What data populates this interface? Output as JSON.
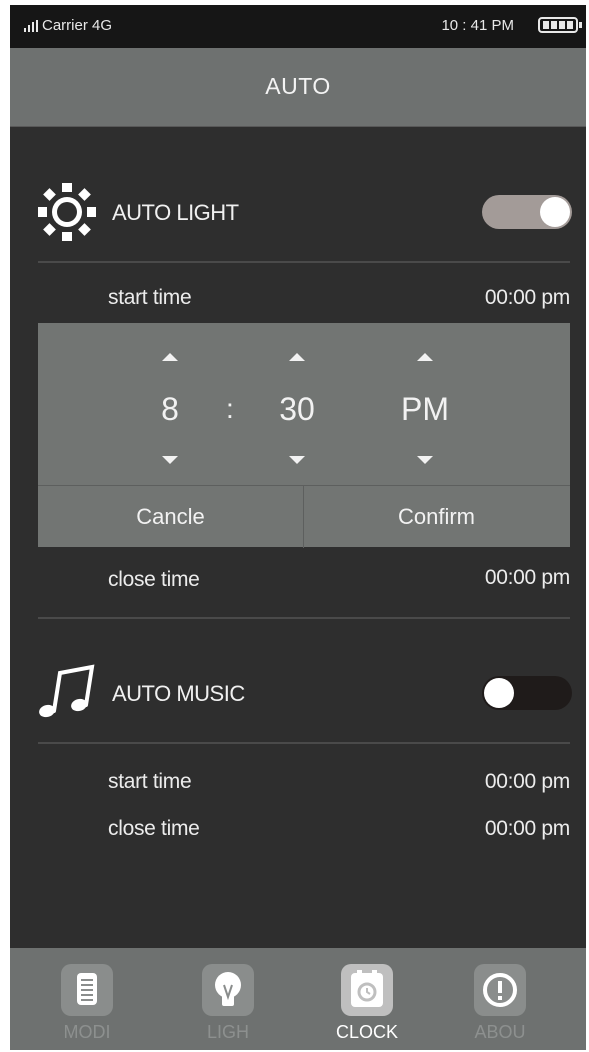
{
  "status_bar": {
    "carrier": "Carrier",
    "network": "4G",
    "time": "10 : 41 PM"
  },
  "header": {
    "title": "AUTO"
  },
  "auto_light": {
    "label": "AUTO LIGHT",
    "icon": "sun-icon",
    "enabled": true,
    "start_time_label": "start time",
    "start_time_value": "00:00 pm",
    "close_time_label": "close time",
    "close_time_value": "00:00 pm"
  },
  "time_picker": {
    "hour": "8",
    "separator": ":",
    "minute": "30",
    "ampm": "PM",
    "cancel_label": "Cancle",
    "confirm_label": "Confirm"
  },
  "auto_music": {
    "label": "AUTO MUSIC",
    "icon": "music-note-icon",
    "enabled": false,
    "start_time_label": "start time",
    "start_time_value": "00:00 pm",
    "close_time_label": "close time",
    "close_time_value": "00:00 pm"
  },
  "tabs": [
    {
      "label": "MODI",
      "icon": "document-icon",
      "active": false
    },
    {
      "label": "LIGH",
      "icon": "bulb-icon",
      "active": false
    },
    {
      "label": "CLOCK",
      "icon": "clock-icon",
      "active": true
    },
    {
      "label": "ABOU",
      "icon": "info-icon",
      "active": false
    }
  ],
  "colors": {
    "background": "#2e2e2e",
    "header": "#6e7170",
    "toggle_on": "#a39b98",
    "toggle_off": "#1f1b1a"
  }
}
